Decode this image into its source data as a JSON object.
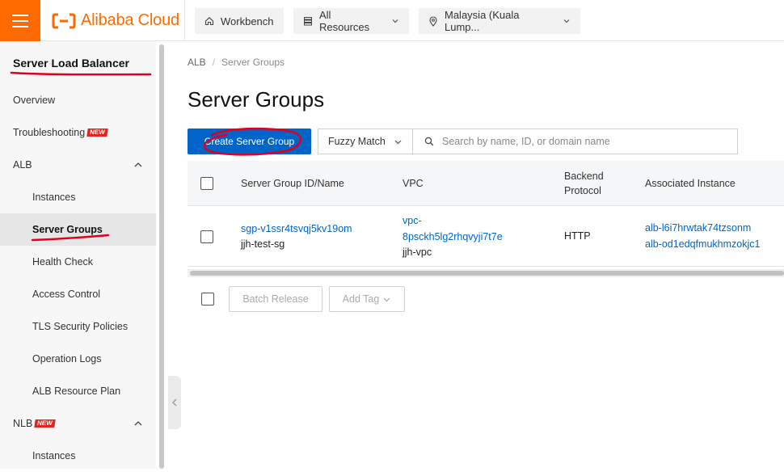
{
  "topbar": {
    "brand": "Alibaba Cloud",
    "workbench": "Workbench",
    "all_resources": "All Resources",
    "region": "Malaysia (Kuala Lump..."
  },
  "sidebar": {
    "title": "Server Load Balancer",
    "items": [
      {
        "label": "Overview"
      },
      {
        "label": "Troubleshooting",
        "badge": "NEW"
      },
      {
        "label": "ALB"
      },
      {
        "label": "Instances"
      },
      {
        "label": "Server Groups"
      },
      {
        "label": "Health Check"
      },
      {
        "label": "Access Control"
      },
      {
        "label": "TLS Security Policies"
      },
      {
        "label": "Operation Logs"
      },
      {
        "label": "ALB Resource Plan"
      },
      {
        "label": "NLB",
        "badge": "NEW"
      },
      {
        "label": "Instances"
      }
    ]
  },
  "breadcrumb": {
    "root": "ALB",
    "sep": "/",
    "current": "Server Groups"
  },
  "page_title": "Server Groups",
  "toolbar": {
    "create_label": "Create Server Group",
    "match_mode": "Fuzzy Match",
    "search_placeholder": "Search by name, ID, or domain name"
  },
  "table": {
    "columns": [
      "Server Group ID/Name",
      "VPC",
      "Backend Protocol",
      "Associated Instance"
    ],
    "rows": [
      {
        "id": "sgp-v1ssr4tsvqj5kv19om",
        "name": "jjh-test-sg",
        "vpc_id_1": "vpc-",
        "vpc_id_2": "8psckh5lg2rhqvyji7t7e",
        "vpc_name": "jjh-vpc",
        "protocol": "HTTP",
        "instance_1": "alb-l6i7hrwtak74tzsonm",
        "instance_2": "alb-od1edqfmukhmzokjc1"
      }
    ]
  },
  "footer": {
    "batch_release": "Batch Release",
    "add_tag": "Add Tag"
  },
  "colors": {
    "brand": "#ff6a00",
    "primary": "#0064c8",
    "link": "#0064c8",
    "annotation": "#e0001b"
  }
}
